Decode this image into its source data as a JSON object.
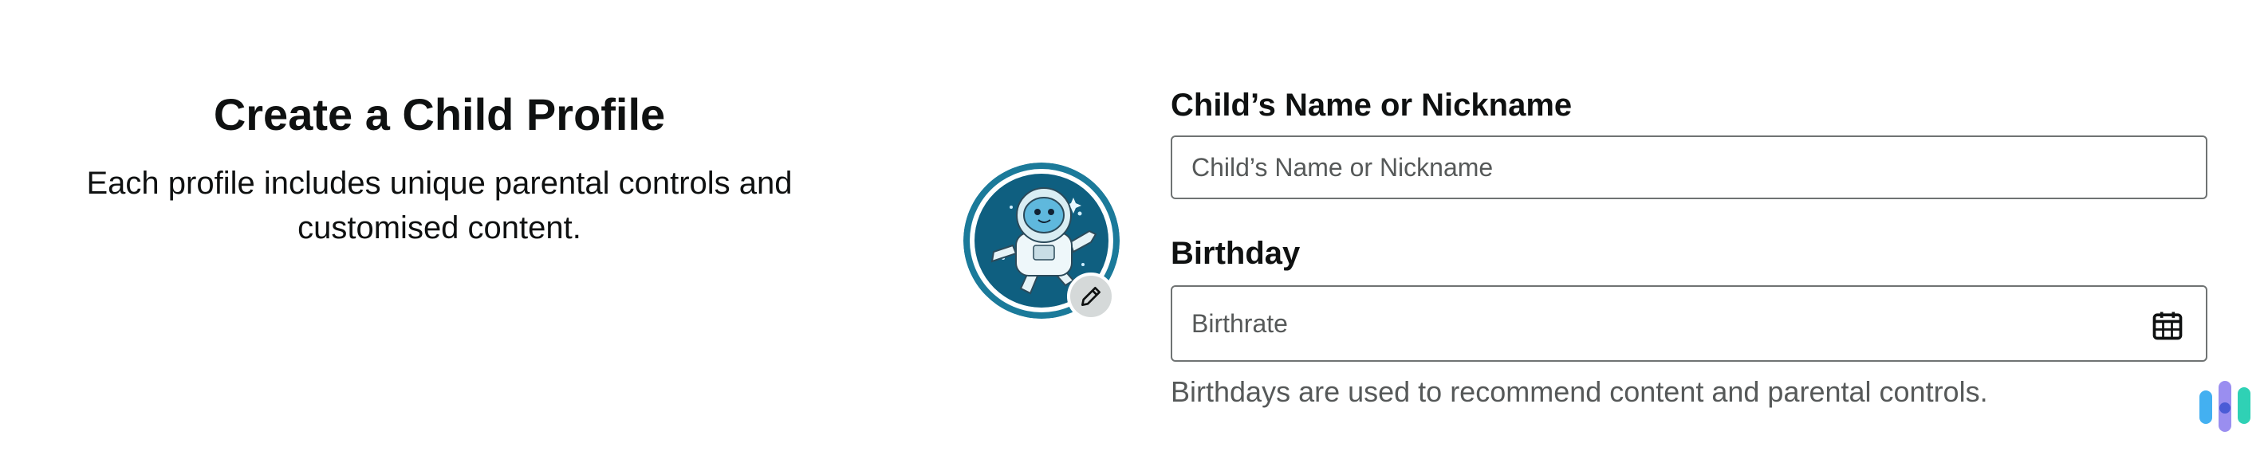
{
  "intro": {
    "title": "Create a Child Profile",
    "subtitle": "Each profile includes unique parental controls and customised content."
  },
  "avatar": {
    "icon": "astronaut-avatar",
    "edit_icon": "pencil-icon"
  },
  "form": {
    "name_label": "Child’s Name or Nickname",
    "name_placeholder": "Child’s Name or Nickname",
    "name_value": "",
    "birthday_label": "Birthday",
    "birthday_placeholder": "Birthrate",
    "birthday_value": "",
    "birthday_icon": "calendar-icon",
    "birthday_help": "Birthdays are used to recommend content and parental controls."
  },
  "colors": {
    "avatar_ring": "#1b7a9a",
    "avatar_bg": "#0f5f80",
    "input_border": "#6f7373",
    "helper_text": "#565959",
    "edit_button_bg": "#d5d9d9"
  }
}
